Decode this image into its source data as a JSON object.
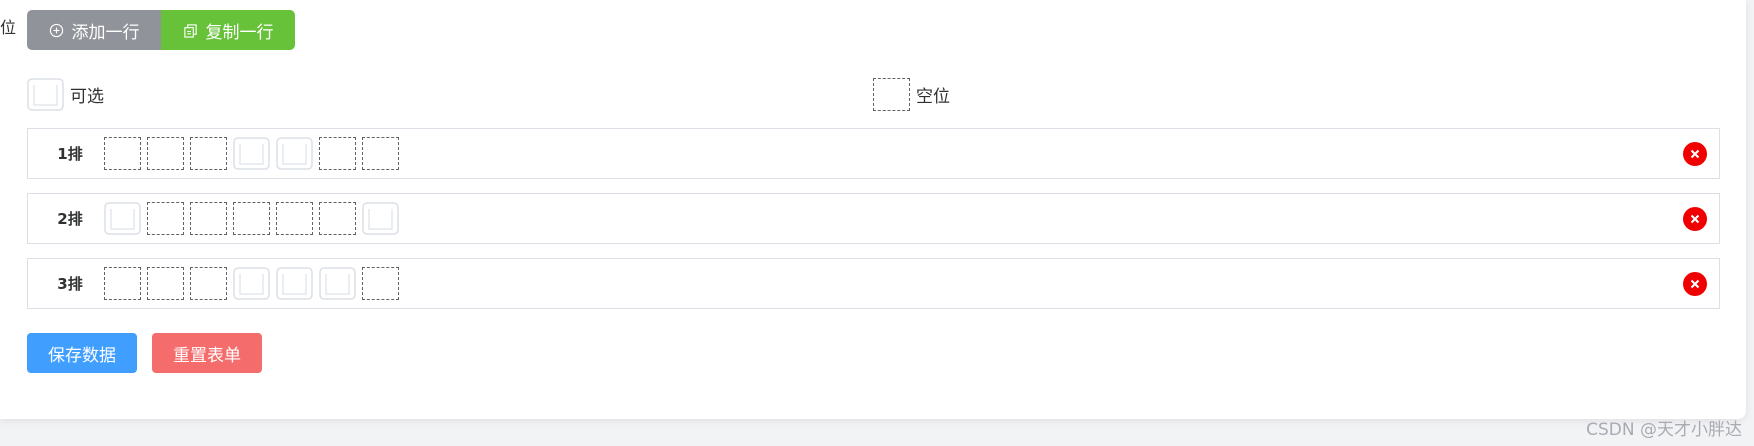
{
  "page": {
    "cut_label": "位",
    "watermark": "CSDN @天才小胖达"
  },
  "toolbar": {
    "add_row_label": "添加一行",
    "copy_row_label": "复制一行"
  },
  "legend": {
    "optional_label": "可选",
    "empty_label": "空位"
  },
  "rows": [
    {
      "label": "1排",
      "seats": [
        "empty",
        "empty",
        "empty",
        "optional",
        "optional",
        "empty",
        "empty"
      ]
    },
    {
      "label": "2排",
      "seats": [
        "optional",
        "empty",
        "empty",
        "empty",
        "empty",
        "empty",
        "optional"
      ]
    },
    {
      "label": "3排",
      "seats": [
        "empty",
        "empty",
        "empty",
        "optional",
        "optional",
        "optional",
        "empty"
      ]
    }
  ],
  "actions": {
    "save_label": "保存数据",
    "reset_label": "重置表单"
  },
  "colors": {
    "add_button": "#909399",
    "copy_button": "#67c23a",
    "save_button": "#409eff",
    "reset_button": "#f56c6c",
    "delete_icon": "#f00000"
  },
  "icons": {
    "add": "plus-circle-icon",
    "copy": "copy-icon",
    "delete": "close-circle-icon",
    "optional_seat": "seat-icon"
  }
}
